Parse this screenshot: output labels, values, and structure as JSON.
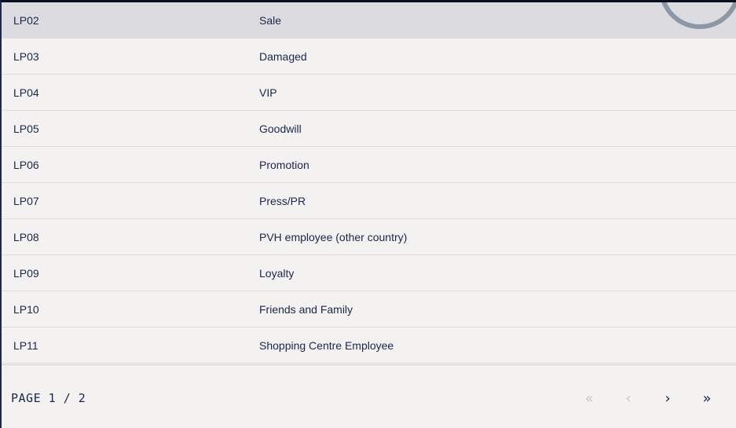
{
  "table": {
    "rows": [
      {
        "code": "LP02",
        "description": "Sale",
        "selected": true
      },
      {
        "code": "LP03",
        "description": "Damaged"
      },
      {
        "code": "LP04",
        "description": "VIP"
      },
      {
        "code": "LP05",
        "description": "Goodwill"
      },
      {
        "code": "LP06",
        "description": "Promotion"
      },
      {
        "code": "LP07",
        "description": "Press/PR"
      },
      {
        "code": "LP08",
        "description": "PVH employee (other country)"
      },
      {
        "code": "LP09",
        "description": "Loyalty"
      },
      {
        "code": "LP10",
        "description": "Friends and Family"
      },
      {
        "code": "LP11",
        "description": "Shopping Centre Employee"
      }
    ]
  },
  "pagination": {
    "label": "PAGE 1 / 2",
    "first_icon": "«",
    "prev_icon": "‹",
    "next_icon": "›",
    "last_icon": "»",
    "first_enabled": false,
    "prev_enabled": false,
    "next_enabled": true,
    "last_enabled": true
  },
  "colors": {
    "text": "#1b2550",
    "selected_row_bg": "#dcdbdf",
    "background": "#f3f2f1",
    "loader_ring": "#8c98a6",
    "loader_accent": "#e07a40"
  },
  "icons": {
    "loader": "loading-spinner-icon",
    "first": "double-chevron-left-icon",
    "prev": "chevron-left-icon",
    "next": "chevron-right-icon",
    "last": "double-chevron-right-icon"
  }
}
